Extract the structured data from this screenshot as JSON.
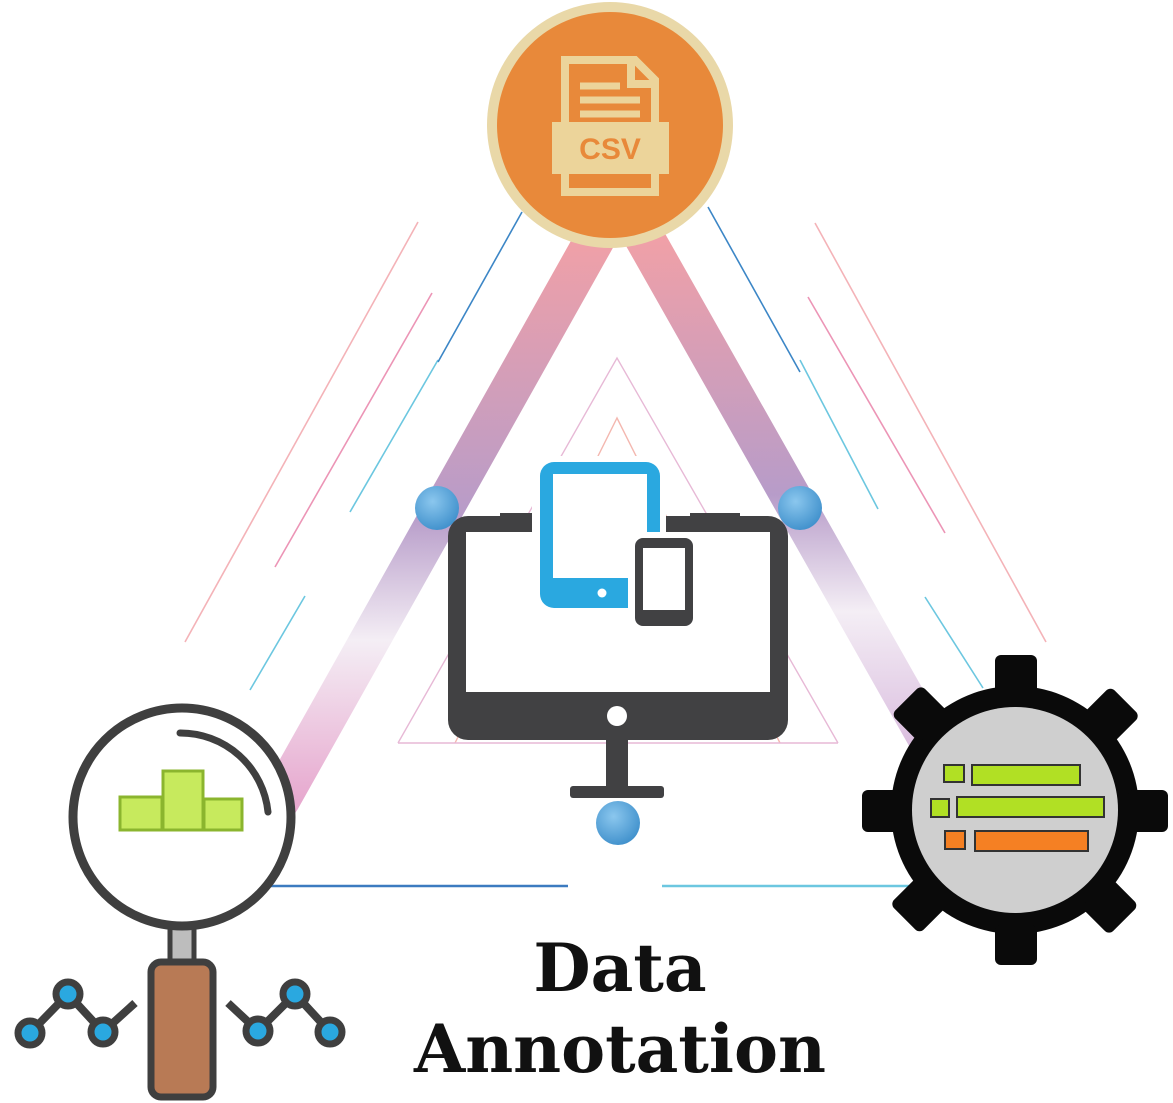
{
  "title": {
    "line1": "Data",
    "line2": "Annotation"
  },
  "csv_icon": {
    "label": "CSV",
    "icon": "csv-file-icon"
  },
  "center_icon": "devices-monitor-icon",
  "analytics_icon": "magnifier-bar-chart-icon",
  "settings_icon": "gear-list-icon",
  "colors": {
    "csv_circle": "#E8893A",
    "csv_ring": "#E9D8A8",
    "node": "#5AA7DA",
    "monitor": "#414143",
    "tablet": "#2AA8E0",
    "chart_green": "#B5DE4A",
    "gear": "#0A0A0A",
    "gear_face": "#CFCFCF",
    "bar_green": "#B1E024",
    "bar_orange": "#F58023",
    "handle": "#B87A55"
  }
}
